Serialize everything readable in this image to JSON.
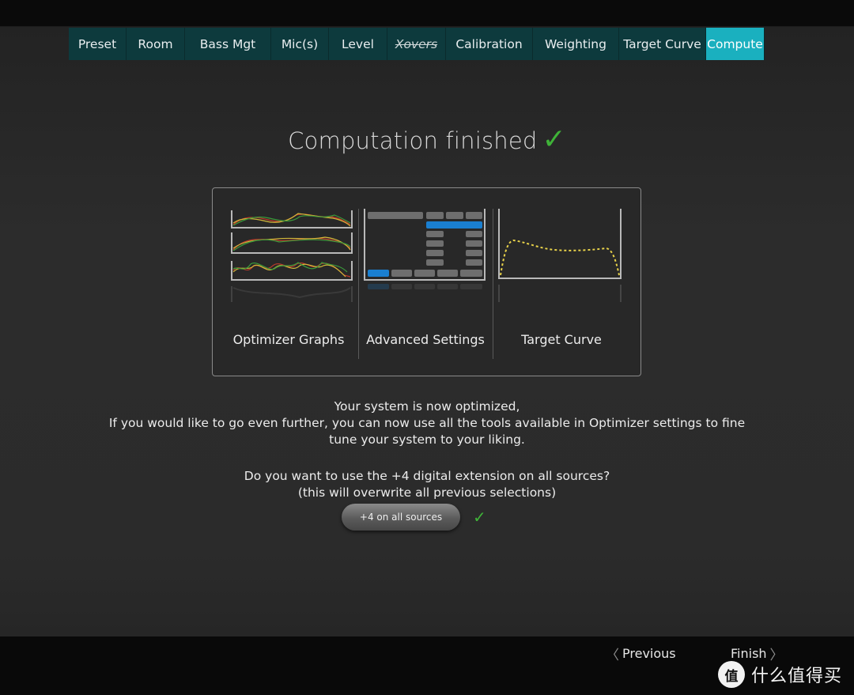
{
  "tabs": [
    {
      "label": "Preset",
      "state": "normal"
    },
    {
      "label": "Room",
      "state": "normal"
    },
    {
      "label": "Bass Mgt",
      "state": "normal"
    },
    {
      "label": "Mic(s)",
      "state": "normal"
    },
    {
      "label": "Level",
      "state": "normal"
    },
    {
      "label": "Xovers",
      "state": "disabled"
    },
    {
      "label": "Calibration",
      "state": "normal"
    },
    {
      "label": "Weighting",
      "state": "normal"
    },
    {
      "label": "Target Curve",
      "state": "normal"
    },
    {
      "label": "Compute",
      "state": "active"
    }
  ],
  "status": {
    "title": "Computation finished",
    "check_icon": "check-icon",
    "check_color": "#3fb338"
  },
  "options": {
    "optimizer_graphs": {
      "label": "Optimizer Graphs",
      "icon": "graphs-thumbnail"
    },
    "advanced_settings": {
      "label": "Advanced Settings",
      "icon": "settings-grid-thumbnail"
    },
    "target_curve": {
      "label": "Target Curve",
      "icon": "target-curve-thumbnail"
    }
  },
  "message": {
    "line1": "Your system is now optimized,",
    "line2": "If you would like to go even further, you can now use all the tools available in Optimizer settings to fine",
    "line3": "tune your system to your liking."
  },
  "extension": {
    "question": "Do you want to use the +4 digital extension on all sources?",
    "note": "(this will overwrite all previous selections)",
    "button_label": "+4 on all sources",
    "applied": true
  },
  "navigation": {
    "previous_label": "Previous",
    "finish_label": "Finish"
  },
  "watermark": {
    "logo": "值",
    "text": "什么值得买"
  },
  "colors": {
    "tab_bg": "#0d3a3d",
    "tab_active": "#1ab0bf",
    "accent_blue": "#1a7fd0",
    "curve_yellow": "#e8d24a"
  }
}
